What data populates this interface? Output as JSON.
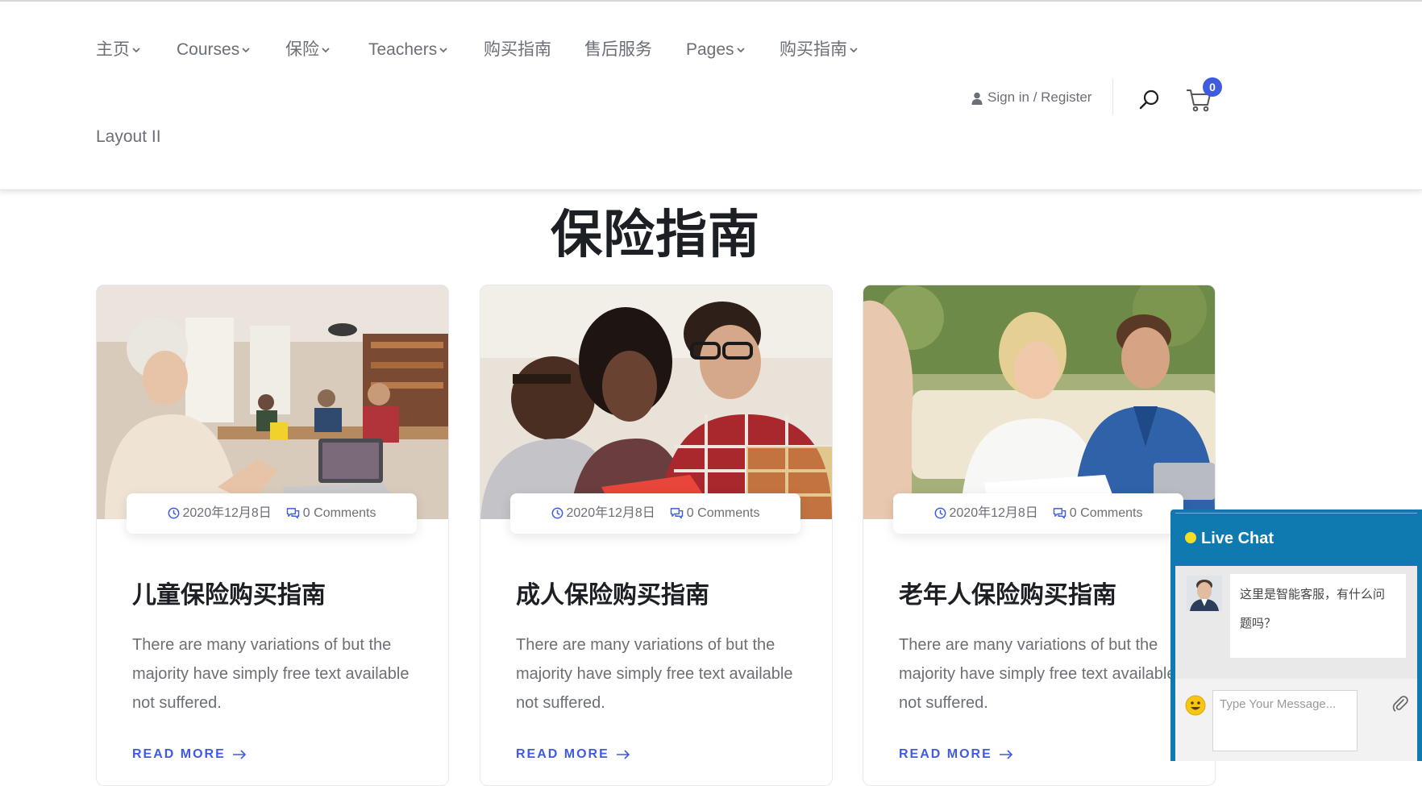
{
  "header": {
    "nav": [
      {
        "label": "主页",
        "has_dropdown": true
      },
      {
        "label": "Courses",
        "has_dropdown": true
      },
      {
        "label": "保险",
        "has_dropdown": true
      },
      {
        "label": "Teachers",
        "has_dropdown": true
      },
      {
        "label": "购买指南",
        "has_dropdown": false
      },
      {
        "label": "售后服务",
        "has_dropdown": false
      },
      {
        "label": "Pages",
        "has_dropdown": true
      },
      {
        "label": "购买指南",
        "has_dropdown": true
      },
      {
        "label": "Layout II",
        "has_dropdown": false
      }
    ],
    "signin_label": "Sign in / Register",
    "cart_count": "0",
    "icons": {
      "user": "user-icon",
      "search": "search-icon",
      "cart": "cart-icon",
      "chevron": "chevron-down-icon"
    },
    "accent_color": "#3f5be0"
  },
  "page_title": "保险指南",
  "cards": [
    {
      "date": "2020年12月8日",
      "comments": "0 Comments",
      "title": "儿童保险购买指南",
      "excerpt": "There are many variations of but the majority have simply free text available not suffered.",
      "read_more": "READ MORE"
    },
    {
      "date": "2020年12月8日",
      "comments": "0 Comments",
      "title": "成人保险购买指南",
      "excerpt": "There are many variations of but the majority have simply free text available not suffered.",
      "read_more": "READ MORE"
    },
    {
      "date": "2020年12月8日",
      "comments": "0 Comments",
      "title": "老年人保险购买指南",
      "excerpt": "There are many variations of but the majority have simply free text available not suffered.",
      "read_more": "READ MORE"
    }
  ],
  "chat": {
    "title": "Live Chat",
    "message": "这里是智能客服，有什么问题吗？",
    "input_placeholder": "Type Your Message...",
    "header_color": "#0f7ab0",
    "status_color": "#f3dd25",
    "icons": {
      "emoji": "smiley-emoji-icon",
      "attach": "paperclip-icon"
    }
  }
}
